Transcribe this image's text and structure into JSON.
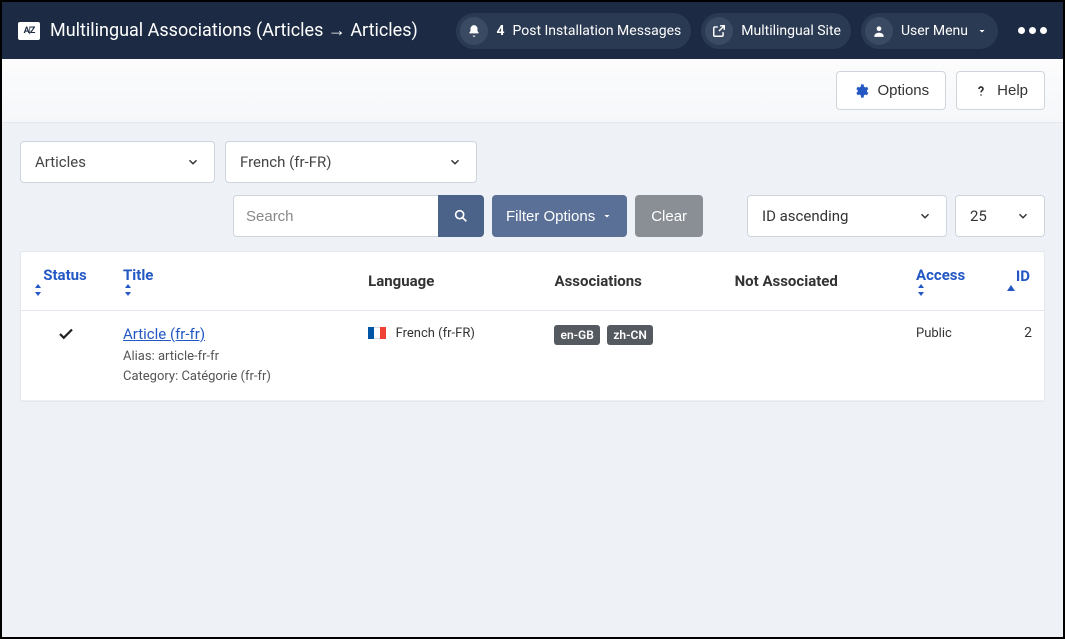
{
  "header": {
    "title": "Multilingual Associations (Articles → Articles)",
    "notifications_count": "4",
    "notifications_label": "Post Installation Messages",
    "site_link": "Multilingual Site",
    "user_menu": "User Menu"
  },
  "toolbar": {
    "options_label": "Options",
    "help_label": "Help"
  },
  "filters": {
    "item_type": "Articles",
    "language": "French (fr-FR)"
  },
  "search": {
    "placeholder": "Search",
    "filter_options_label": "Filter Options",
    "clear_label": "Clear",
    "sort": "ID ascending",
    "limit": "25"
  },
  "table": {
    "headers": {
      "status": "Status",
      "title": "Title",
      "language": "Language",
      "associations": "Associations",
      "not_associated": "Not Associated",
      "access": "Access",
      "id": "ID"
    },
    "rows": [
      {
        "title": "Article (fr-fr)",
        "alias_label": "Alias:",
        "alias": "article-fr-fr",
        "category_label": "Category:",
        "category": "Catégorie (fr-fr)",
        "language": "French (fr-FR)",
        "associations": [
          "en-GB",
          "zh-CN"
        ],
        "access": "Public",
        "id": "2"
      }
    ]
  }
}
